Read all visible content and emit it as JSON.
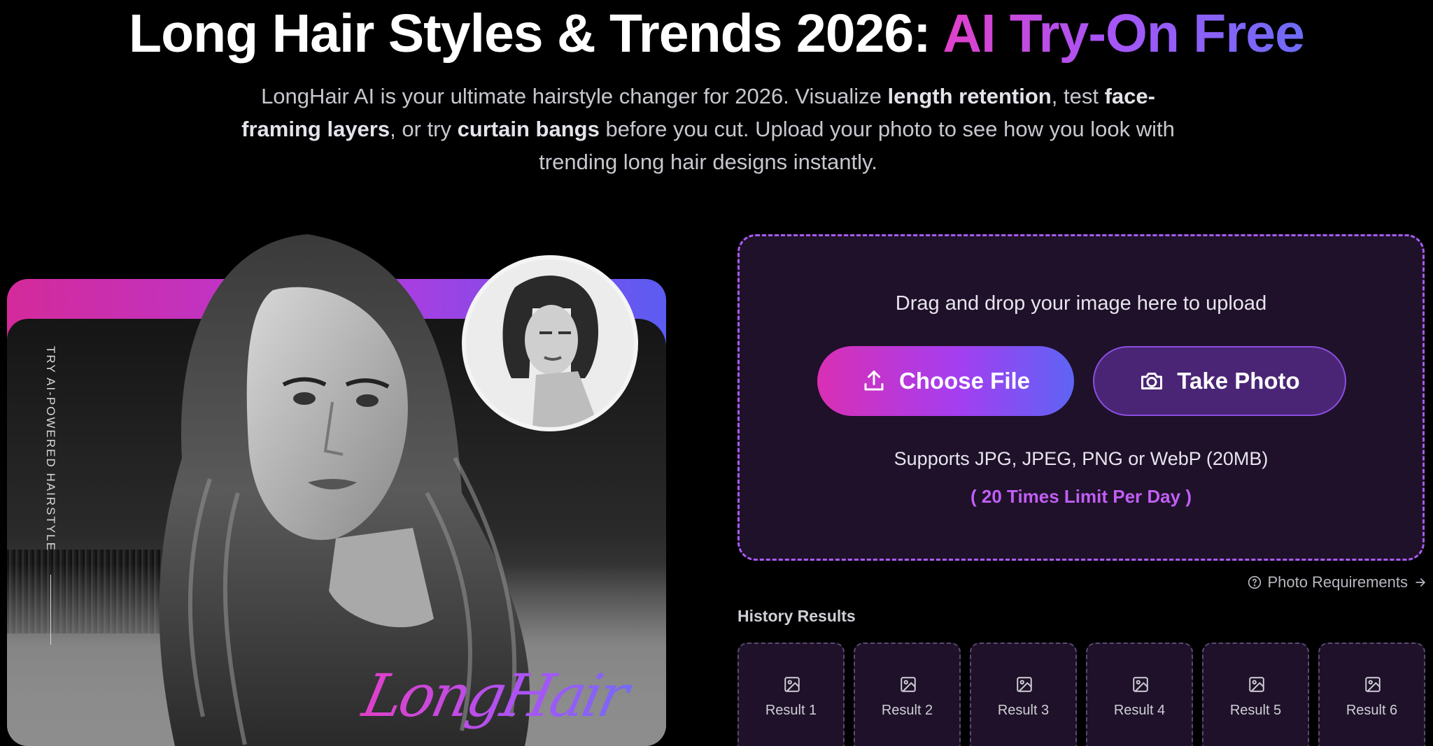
{
  "hero": {
    "title_main": "Long Hair Styles & Trends 2026: ",
    "title_accent": "AI Try-On Free",
    "sub_1": "LongHair AI is your ultimate hairstyle changer for 2026. Visualize ",
    "sub_b1": "length retention",
    "sub_2": ", test ",
    "sub_b2": "face-framing layers",
    "sub_3": ", or try ",
    "sub_b3": "curtain bangs",
    "sub_4": " before you cut. Upload your photo to see how you look with trending long hair designs instantly."
  },
  "showcase": {
    "vertical_tag": "TRY AI-POWERED HAIRSTYLE",
    "brand_script": "LongHair"
  },
  "upload": {
    "hint": "Drag and drop your image here to upload",
    "choose_label": "Choose File",
    "photo_label": "Take Photo",
    "formats": "Supports JPG, JPEG, PNG or WebP (20MB)",
    "limit": "( 20 Times Limit Per Day )",
    "requirements": "Photo Requirements"
  },
  "history": {
    "title": "History Results",
    "items": [
      "Result 1",
      "Result 2",
      "Result 3",
      "Result 4",
      "Result 5",
      "Result 6"
    ]
  },
  "colors": {
    "accent_pink": "#e040c8",
    "accent_purple": "#a855f7",
    "accent_blue": "#6d6cf7",
    "panel_bg": "#1e1129"
  }
}
